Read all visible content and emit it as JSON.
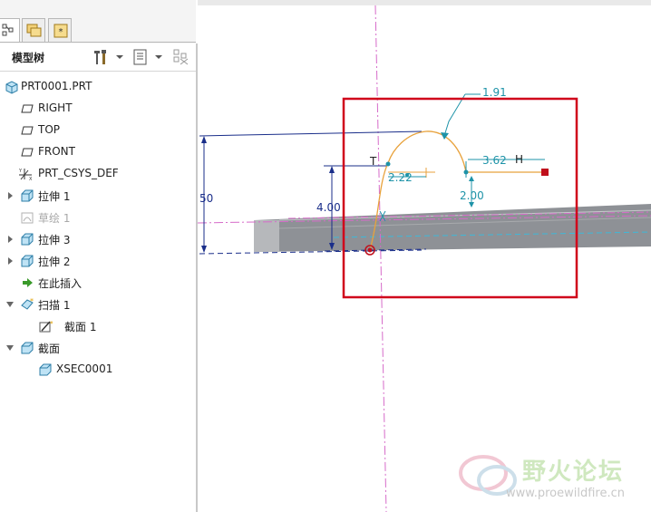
{
  "tree_header": {
    "title": "模型树"
  },
  "tree": {
    "root": "PRT0001.PRT",
    "items": [
      {
        "label": "RIGHT",
        "icon": "datum-plane-icon"
      },
      {
        "label": "TOP",
        "icon": "datum-plane-icon"
      },
      {
        "label": "FRONT",
        "icon": "datum-plane-icon"
      },
      {
        "label": "PRT_CSYS_DEF",
        "icon": "csys-icon"
      },
      {
        "label": "拉伸 1",
        "icon": "extrude-icon"
      },
      {
        "label": "草绘 1",
        "icon": "sketch-icon"
      },
      {
        "label": "拉伸 3",
        "icon": "extrude-icon"
      },
      {
        "label": "拉伸 2",
        "icon": "extrude-icon"
      },
      {
        "label": "在此插入",
        "icon": "insert-here-icon"
      },
      {
        "label": "扫描 1",
        "icon": "sweep-icon"
      },
      {
        "label": "截面 1",
        "icon": "section-sketch-icon"
      },
      {
        "label": "截面",
        "icon": "xsec-folder-icon"
      },
      {
        "label": "XSEC0001",
        "icon": "xsec-icon"
      }
    ]
  },
  "sketch": {
    "dims": {
      "d_191": "1.91",
      "d_222": "2.22",
      "d_362": "3.62",
      "d_200": "2.00",
      "d_400": "4.00",
      "d_50": "50"
    },
    "constraints": {
      "tangent": "T",
      "horizontal": "H"
    },
    "colors": {
      "sketch": "#e8a23c",
      "dimension_blue": "#1e93a8",
      "dimension_navy": "#1a2e8a",
      "highlight": "#d0021b",
      "axis": "#d66bc9",
      "model": "#8e9196"
    }
  },
  "watermark": {
    "name": "野火论坛",
    "url": "www.proewildfire.cn"
  }
}
